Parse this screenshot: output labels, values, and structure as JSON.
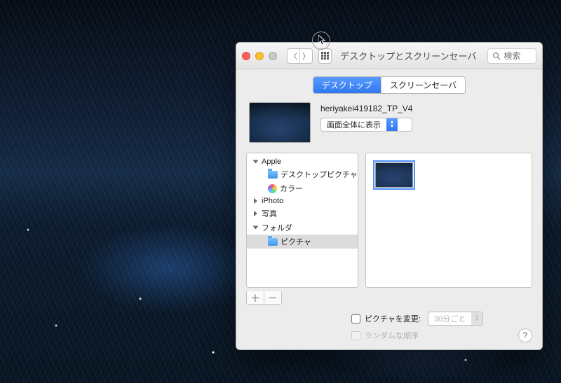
{
  "window": {
    "title": "デスクトップとスクリーンセーバ",
    "search_placeholder": "検索"
  },
  "tabs": {
    "desktop": "デスクトップ",
    "screensaver": "スクリーンセーバ",
    "active": "desktop"
  },
  "current_image": {
    "filename": "heriyakei419182_TP_V4",
    "fit_mode": "画面全体に表示"
  },
  "source_list": {
    "groups": [
      {
        "label": "Apple",
        "expanded": true,
        "items": [
          {
            "label": "デスクトップピクチャ",
            "icon": "folder"
          },
          {
            "label": "カラー",
            "icon": "colorwheel"
          }
        ]
      },
      {
        "label": "iPhoto",
        "expanded": false,
        "items": []
      },
      {
        "label": "写真",
        "expanded": false,
        "items": []
      },
      {
        "label": "フォルダ",
        "expanded": true,
        "items": [
          {
            "label": "ピクチャ",
            "icon": "folder",
            "selected": true
          }
        ]
      }
    ]
  },
  "options": {
    "change_picture_label": "ピクチャを変更:",
    "change_picture_checked": false,
    "interval": "30分ごと",
    "random_order_label": "ランダムな順序",
    "random_order_checked": false
  },
  "buttons": {
    "add": "＋",
    "remove": "－",
    "help": "?"
  }
}
